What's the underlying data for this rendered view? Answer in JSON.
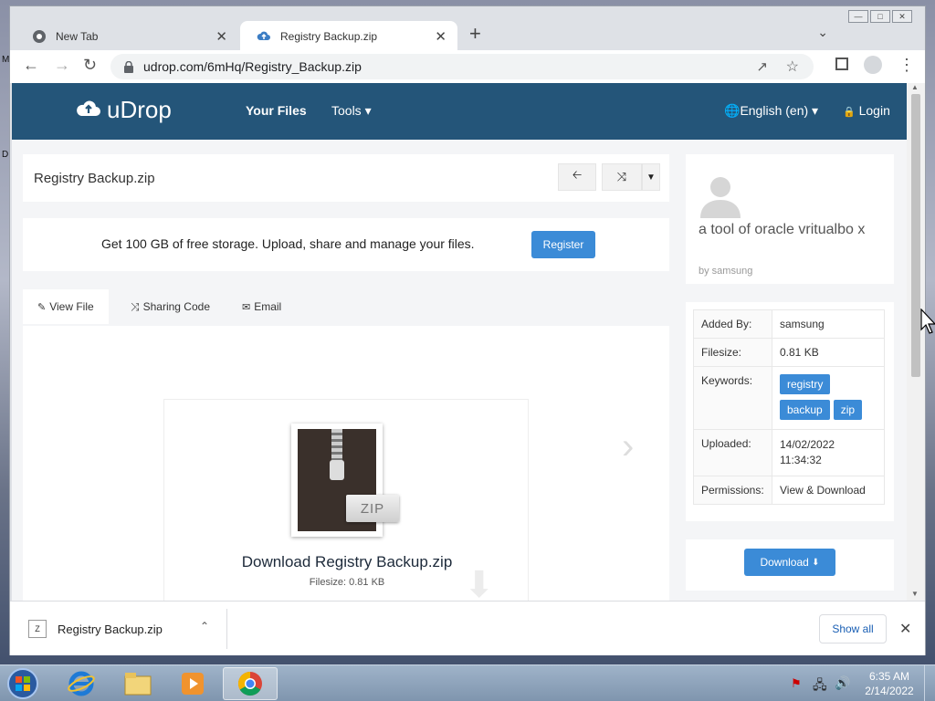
{
  "browser": {
    "tabs": [
      {
        "title": "New Tab"
      },
      {
        "title": "Registry Backup.zip"
      }
    ],
    "url": "udrop.com/6mHq/Registry_Backup.zip"
  },
  "site": {
    "logo_text": "uDrop",
    "nav": {
      "your_files": "Your Files",
      "tools": "Tools",
      "language": "English (en)",
      "login": "Login"
    }
  },
  "file": {
    "title": "Registry Backup.zip",
    "promo_text": "Get 100 GB of free storage. Upload, share and manage your files.",
    "register_label": "Register",
    "tabs": [
      "View File",
      "Sharing Code",
      "Email"
    ],
    "zip_label": "ZIP",
    "download_heading": "Download Registry Backup.zip",
    "filesize_line": "Filesize: 0.81 KB"
  },
  "sidebar": {
    "description": "a tool of oracle vritualbo x",
    "by": "by samsung",
    "rows": [
      {
        "label": "Added By:",
        "value": "samsung"
      },
      {
        "label": "Filesize:",
        "value": "0.81 KB"
      },
      {
        "label": "Keywords:",
        "keywords": [
          "registry",
          "backup",
          "zip"
        ]
      },
      {
        "label": "Uploaded:",
        "value": "14/02/2022 11:34:32"
      },
      {
        "label": "Permissions:",
        "value": "View & Download"
      }
    ],
    "download_label": "Download"
  },
  "download_bar": {
    "filename": "Registry Backup.zip",
    "show_all": "Show all"
  },
  "taskbar": {
    "time": "6:35 AM",
    "date": "2/14/2022"
  },
  "colors": {
    "nav_bg": "#245579",
    "accent_blue": "#3b8bd7"
  }
}
